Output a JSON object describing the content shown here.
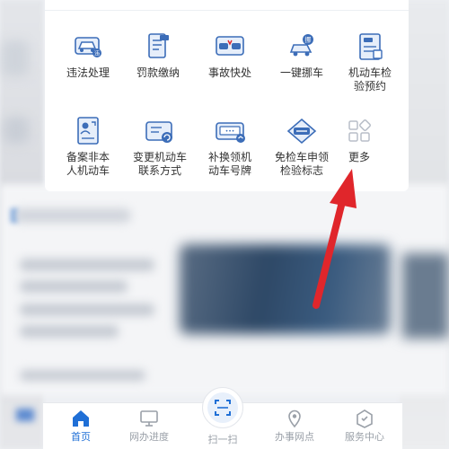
{
  "services": {
    "row1": [
      {
        "label": "违法处理",
        "icon": "car-violation-icon"
      },
      {
        "label": "罚款缴纳",
        "icon": "fine-payment-icon"
      },
      {
        "label": "事故快处",
        "icon": "accident-icon"
      },
      {
        "label": "一键挪车",
        "icon": "move-car-icon"
      },
      {
        "label": "机动车检\n验预约",
        "icon": "inspection-booking-icon"
      }
    ],
    "row2": [
      {
        "label": "备案非本\n人机动车",
        "icon": "vehicle-registration-icon"
      },
      {
        "label": "变更机动车\n联系方式",
        "icon": "contact-change-icon"
      },
      {
        "label": "补换领机\n动车号牌",
        "icon": "license-plate-icon"
      },
      {
        "label": "免检车申领\n检验标志",
        "icon": "exempt-badge-icon"
      },
      {
        "label": "更多",
        "icon": "more-grid-icon"
      }
    ]
  },
  "tabbar": {
    "items": [
      {
        "label": "首页",
        "icon": "home-icon",
        "active": true
      },
      {
        "label": "网办进度",
        "icon": "monitor-icon",
        "active": false
      },
      {
        "label": "扫一扫",
        "icon": "scan-icon",
        "active": false
      },
      {
        "label": "办事网点",
        "icon": "location-icon",
        "active": false
      },
      {
        "label": "服务中心",
        "icon": "service-center-icon",
        "active": false
      }
    ]
  },
  "colors": {
    "accent": "#1f6fd6",
    "icon_stroke": "#3c6db8",
    "arrow": "#e0262b",
    "inactive": "#9aa0a8"
  }
}
